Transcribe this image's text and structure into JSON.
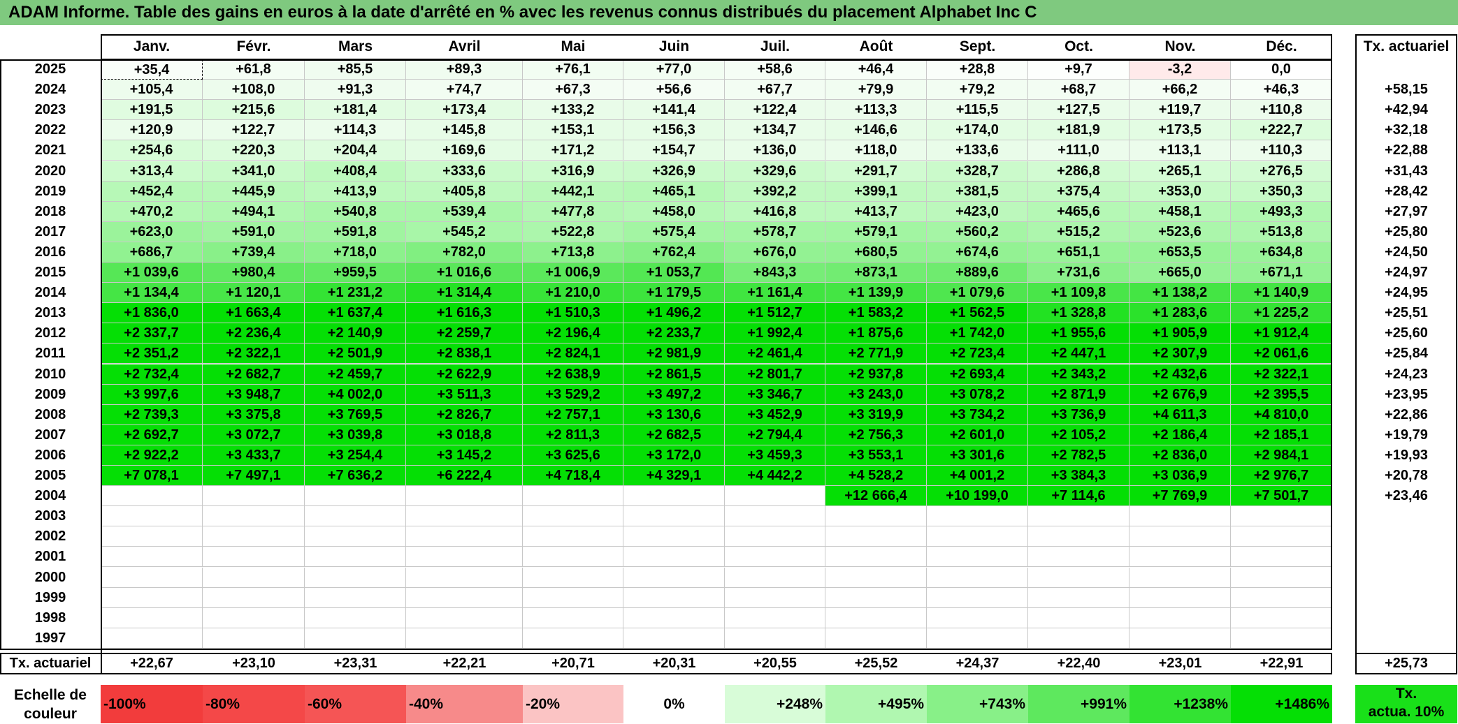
{
  "title": "ADAM Informe. Table des gains en euros à la date d'arrêté en % avec les revenus connus distribués du placement Alphabet Inc C",
  "months": [
    "Janv.",
    "Févr.",
    "Mars",
    "Avril",
    "Mai",
    "Juin",
    "Juil.",
    "Août",
    "Sept.",
    "Oct.",
    "Nov.",
    "Déc."
  ],
  "actuarial_header": "Tx. actuariel",
  "rows": [
    {
      "year": "2025",
      "values": [
        "+35,4",
        "+61,8",
        "+85,5",
        "+89,3",
        "+76,1",
        "+77,0",
        "+58,6",
        "+46,4",
        "+28,8",
        "+9,7",
        "-3,2",
        "0,0"
      ],
      "rate": ""
    },
    {
      "year": "2024",
      "values": [
        "+105,4",
        "+108,0",
        "+91,3",
        "+74,7",
        "+67,3",
        "+56,6",
        "+67,7",
        "+79,9",
        "+79,2",
        "+68,7",
        "+66,2",
        "+46,3"
      ],
      "rate": "+58,15"
    },
    {
      "year": "2023",
      "values": [
        "+191,5",
        "+215,6",
        "+181,4",
        "+173,4",
        "+133,2",
        "+141,4",
        "+122,4",
        "+113,3",
        "+115,5",
        "+127,5",
        "+119,7",
        "+110,8"
      ],
      "rate": "+42,94"
    },
    {
      "year": "2022",
      "values": [
        "+120,9",
        "+122,7",
        "+114,3",
        "+145,8",
        "+153,1",
        "+156,3",
        "+134,7",
        "+146,6",
        "+174,0",
        "+181,9",
        "+173,5",
        "+222,7"
      ],
      "rate": "+32,18"
    },
    {
      "year": "2021",
      "values": [
        "+254,6",
        "+220,3",
        "+204,4",
        "+169,6",
        "+171,2",
        "+154,7",
        "+136,0",
        "+118,0",
        "+133,6",
        "+111,0",
        "+113,1",
        "+110,3"
      ],
      "rate": "+22,88"
    },
    {
      "year": "2020",
      "values": [
        "+313,4",
        "+341,0",
        "+408,4",
        "+333,6",
        "+316,9",
        "+326,9",
        "+329,6",
        "+291,7",
        "+328,7",
        "+286,8",
        "+265,1",
        "+276,5"
      ],
      "rate": "+31,43"
    },
    {
      "year": "2019",
      "values": [
        "+452,4",
        "+445,9",
        "+413,9",
        "+405,8",
        "+442,1",
        "+465,1",
        "+392,2",
        "+399,1",
        "+381,5",
        "+375,4",
        "+353,0",
        "+350,3"
      ],
      "rate": "+28,42"
    },
    {
      "year": "2018",
      "values": [
        "+470,2",
        "+494,1",
        "+540,8",
        "+539,4",
        "+477,8",
        "+458,0",
        "+416,8",
        "+413,7",
        "+423,0",
        "+465,6",
        "+458,1",
        "+493,3"
      ],
      "rate": "+27,97"
    },
    {
      "year": "2017",
      "values": [
        "+623,0",
        "+591,0",
        "+591,8",
        "+545,2",
        "+522,8",
        "+575,4",
        "+578,7",
        "+579,1",
        "+560,2",
        "+515,2",
        "+523,6",
        "+513,8"
      ],
      "rate": "+25,80"
    },
    {
      "year": "2016",
      "values": [
        "+686,7",
        "+739,4",
        "+718,0",
        "+782,0",
        "+713,8",
        "+762,4",
        "+676,0",
        "+680,5",
        "+674,6",
        "+651,1",
        "+653,5",
        "+634,8"
      ],
      "rate": "+24,50"
    },
    {
      "year": "2015",
      "values": [
        "+1 039,6",
        "+980,4",
        "+959,5",
        "+1 016,6",
        "+1 006,9",
        "+1 053,7",
        "+843,3",
        "+873,1",
        "+889,6",
        "+731,6",
        "+665,0",
        "+671,1"
      ],
      "rate": "+24,97"
    },
    {
      "year": "2014",
      "values": [
        "+1 134,4",
        "+1 120,1",
        "+1 231,2",
        "+1 314,4",
        "+1 210,0",
        "+1 179,5",
        "+1 161,4",
        "+1 139,9",
        "+1 079,6",
        "+1 109,8",
        "+1 138,2",
        "+1 140,9"
      ],
      "rate": "+24,95"
    },
    {
      "year": "2013",
      "values": [
        "+1 836,0",
        "+1 663,4",
        "+1 637,4",
        "+1 616,3",
        "+1 510,3",
        "+1 496,2",
        "+1 512,7",
        "+1 583,2",
        "+1 562,5",
        "+1 328,8",
        "+1 283,6",
        "+1 225,2"
      ],
      "rate": "+25,51"
    },
    {
      "year": "2012",
      "values": [
        "+2 337,7",
        "+2 236,4",
        "+2 140,9",
        "+2 259,7",
        "+2 196,4",
        "+2 233,7",
        "+1 992,4",
        "+1 875,6",
        "+1 742,0",
        "+1 955,6",
        "+1 905,9",
        "+1 912,4"
      ],
      "rate": "+25,60"
    },
    {
      "year": "2011",
      "values": [
        "+2 351,2",
        "+2 322,1",
        "+2 501,9",
        "+2 838,1",
        "+2 824,1",
        "+2 981,9",
        "+2 461,4",
        "+2 771,9",
        "+2 723,4",
        "+2 447,1",
        "+2 307,9",
        "+2 061,6"
      ],
      "rate": "+25,84"
    },
    {
      "year": "2010",
      "values": [
        "+2 732,4",
        "+2 682,7",
        "+2 459,7",
        "+2 622,9",
        "+2 638,9",
        "+2 861,5",
        "+2 801,7",
        "+2 937,8",
        "+2 693,4",
        "+2 343,2",
        "+2 432,6",
        "+2 322,1"
      ],
      "rate": "+24,23"
    },
    {
      "year": "2009",
      "values": [
        "+3 997,6",
        "+3 948,7",
        "+4 002,0",
        "+3 511,3",
        "+3 529,2",
        "+3 497,2",
        "+3 346,7",
        "+3 243,0",
        "+3 078,2",
        "+2 871,9",
        "+2 676,9",
        "+2 395,5"
      ],
      "rate": "+23,95"
    },
    {
      "year": "2008",
      "values": [
        "+2 739,3",
        "+3 375,8",
        "+3 769,5",
        "+2 826,7",
        "+2 757,1",
        "+3 130,6",
        "+3 452,9",
        "+3 319,9",
        "+3 734,2",
        "+3 736,9",
        "+4 611,3",
        "+4 810,0"
      ],
      "rate": "+22,86"
    },
    {
      "year": "2007",
      "values": [
        "+2 692,7",
        "+3 072,7",
        "+3 039,8",
        "+3 018,8",
        "+2 811,3",
        "+2 682,5",
        "+2 794,4",
        "+2 756,3",
        "+2 601,0",
        "+2 105,2",
        "+2 186,4",
        "+2 185,1"
      ],
      "rate": "+19,79"
    },
    {
      "year": "2006",
      "values": [
        "+2 922,2",
        "+3 433,7",
        "+3 254,4",
        "+3 145,2",
        "+3 625,6",
        "+3 172,0",
        "+3 459,3",
        "+3 553,1",
        "+3 301,6",
        "+2 782,5",
        "+2 836,0",
        "+2 984,1"
      ],
      "rate": "+19,93"
    },
    {
      "year": "2005",
      "values": [
        "+7 078,1",
        "+7 497,1",
        "+7 636,2",
        "+6 222,4",
        "+4 718,4",
        "+4 329,1",
        "+4 442,2",
        "+4 528,2",
        "+4 001,2",
        "+3 384,3",
        "+3 036,9",
        "+2 976,7"
      ],
      "rate": "+20,78"
    },
    {
      "year": "2004",
      "values": [
        "",
        "",
        "",
        "",
        "",
        "",
        "",
        "+12 666,4",
        "+10 199,0",
        "+7 114,6",
        "+7 769,9",
        "+7 501,7"
      ],
      "rate": "+23,46"
    },
    {
      "year": "2003",
      "values": [
        "",
        "",
        "",
        "",
        "",
        "",
        "",
        "",
        "",
        "",
        "",
        ""
      ],
      "rate": ""
    },
    {
      "year": "2002",
      "values": [
        "",
        "",
        "",
        "",
        "",
        "",
        "",
        "",
        "",
        "",
        "",
        ""
      ],
      "rate": ""
    },
    {
      "year": "2001",
      "values": [
        "",
        "",
        "",
        "",
        "",
        "",
        "",
        "",
        "",
        "",
        "",
        ""
      ],
      "rate": ""
    },
    {
      "year": "2000",
      "values": [
        "",
        "",
        "",
        "",
        "",
        "",
        "",
        "",
        "",
        "",
        "",
        ""
      ],
      "rate": ""
    },
    {
      "year": "1999",
      "values": [
        "",
        "",
        "",
        "",
        "",
        "",
        "",
        "",
        "",
        "",
        "",
        ""
      ],
      "rate": ""
    },
    {
      "year": "1998",
      "values": [
        "",
        "",
        "",
        "",
        "",
        "",
        "",
        "",
        "",
        "",
        "",
        ""
      ],
      "rate": ""
    },
    {
      "year": "1997",
      "values": [
        "",
        "",
        "",
        "",
        "",
        "",
        "",
        "",
        "",
        "",
        "",
        ""
      ],
      "rate": ""
    }
  ],
  "footer": {
    "label": "Tx. actuariel",
    "values": [
      "+22,67",
      "+23,10",
      "+23,31",
      "+22,21",
      "+20,71",
      "+20,31",
      "+20,55",
      "+25,52",
      "+24,37",
      "+22,40",
      "+23,01",
      "+22,91"
    ],
    "rate": "+25,73"
  },
  "scale": {
    "label_line1": "Echelle de",
    "label_line2": "couleur",
    "items": [
      {
        "text": "-100%",
        "color": "#f23c3c",
        "align": "left"
      },
      {
        "text": "-80%",
        "color": "#f44848",
        "align": "left"
      },
      {
        "text": "-60%",
        "color": "#f55555",
        "align": "left"
      },
      {
        "text": "-40%",
        "color": "#f78a8a",
        "align": "left"
      },
      {
        "text": "-20%",
        "color": "#fbc4c4",
        "align": "left"
      },
      {
        "text": "0%",
        "color": "#ffffff",
        "align": "center"
      },
      {
        "text": "+248%",
        "color": "#d8fcd8",
        "align": "right"
      },
      {
        "text": "+495%",
        "color": "#b0f7b0",
        "align": "right"
      },
      {
        "text": "+743%",
        "color": "#88f088",
        "align": "right"
      },
      {
        "text": "+991%",
        "color": "#5ee85e",
        "align": "right"
      },
      {
        "text": "+1238%",
        "color": "#33e333",
        "align": "right"
      },
      {
        "text": "+1486%",
        "color": "#05df05",
        "align": "right"
      }
    ],
    "legend_line1": "Tx.",
    "legend_line2": "actua. 10%",
    "legend_color": "#19e019"
  }
}
